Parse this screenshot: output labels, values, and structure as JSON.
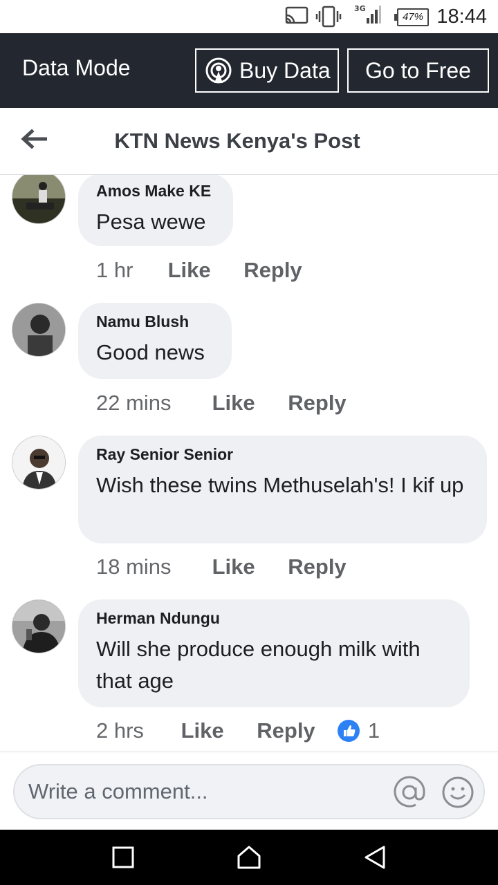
{
  "status": {
    "battery": "47%",
    "time": "18:44",
    "network": "3G"
  },
  "data_bar": {
    "mode_label": "Data Mode",
    "buy_label": "Buy Data",
    "free_label": "Go to Free"
  },
  "header": {
    "title": "KTN News Kenya's Post"
  },
  "comments": [
    {
      "name": "Amos Make KE",
      "text": "Pesa wewe",
      "time": "1 hr",
      "like": "Like",
      "reply": "Reply"
    },
    {
      "name": "Namu Blush",
      "text": "Good news",
      "time": "22 mins",
      "like": "Like",
      "reply": "Reply"
    },
    {
      "name": "Ray Senior Senior",
      "text": "Wish these twins Methuselah's! I kif up",
      "time": "18 mins",
      "like": "Like",
      "reply": "Reply"
    },
    {
      "name": "Herman Ndungu",
      "text": "Will she produce enough milk with that age",
      "time": "2 hrs",
      "like": "Like",
      "reply": "Reply",
      "reaction_count": "1"
    }
  ],
  "composer": {
    "placeholder": "Write a comment..."
  },
  "colors": {
    "data_bar": "#23272f",
    "bubble": "#eff0f3",
    "like_reaction": "#2e81f5"
  }
}
